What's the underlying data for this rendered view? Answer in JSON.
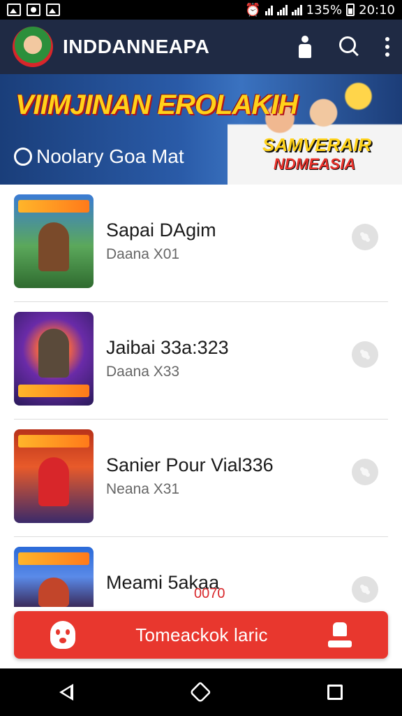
{
  "status_bar": {
    "battery_text": "135%",
    "time": "20:10"
  },
  "app_bar": {
    "title": "INDDANNEAPA",
    "icons": [
      "person-icon",
      "search-icon",
      "more-vert-icon"
    ]
  },
  "banner": {
    "headline": "VIIMJINAN EROLAKIH",
    "subtitle": "Noolary Goa Mat",
    "badge_line1": "SAMVERAIR",
    "badge_line2": "NDMEASIA"
  },
  "list": {
    "items": [
      {
        "title": "Sapai DAgim",
        "subtitle": "Daana X01",
        "extra": ""
      },
      {
        "title": "Jaibai 33a:323",
        "subtitle": "Daana X33",
        "extra": ""
      },
      {
        "title": "Sanier Pour Vial336",
        "subtitle": "Neana X31",
        "extra": ""
      },
      {
        "title": "Meami 5akaa",
        "subtitle": "",
        "extra": "0070"
      }
    ]
  },
  "cta": {
    "label": "Tomeackok laric"
  },
  "colors": {
    "appbar": "#1f2a44",
    "cta": "#e8372e",
    "banner_headline": "#ffd21a"
  }
}
